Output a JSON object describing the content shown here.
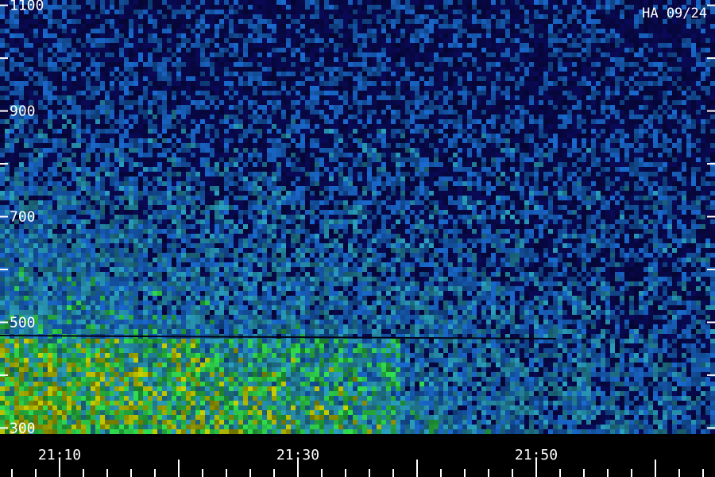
{
  "chart_data": {
    "type": "heatmap",
    "title": "HA 09/24",
    "xlabel": "",
    "ylabel": "",
    "x_tick_labels": [
      {
        "label": "21:10",
        "value": 10
      },
      {
        "label": "21:30",
        "value": 30
      },
      {
        "label": "21:50",
        "value": 50
      }
    ],
    "xlim": [
      5,
      65
    ],
    "y_tick_labels": [
      {
        "label": "1100",
        "value": 1100
      },
      {
        "label": "900",
        "value": 900
      },
      {
        "label": "700",
        "value": 700
      },
      {
        "label": "500",
        "value": 500
      },
      {
        "label": "300",
        "value": 300
      }
    ],
    "ylim": [
      290,
      1110
    ],
    "minor_y_step": 100,
    "minor_x_step": 2,
    "colors": {
      "background": "#000000",
      "low": "#0a0a5a",
      "mid": "#1a6ad0",
      "high": "#30e050",
      "peak": "#c8d000",
      "text": "#ffffff"
    }
  }
}
